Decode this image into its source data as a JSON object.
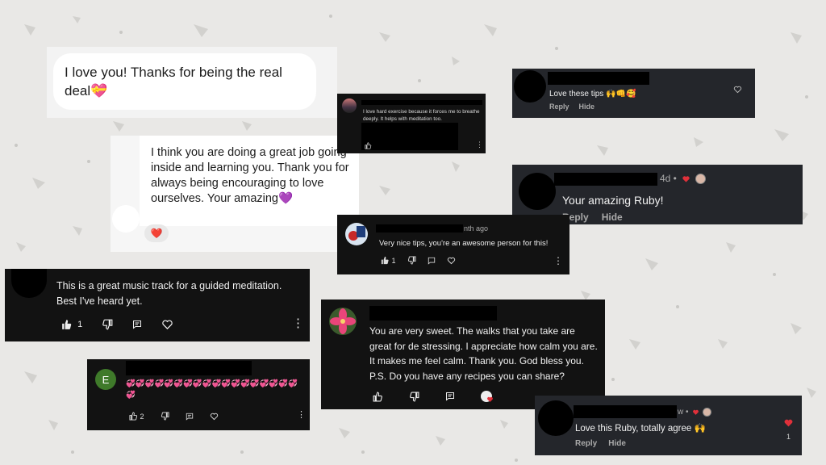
{
  "comments": {
    "c1": {
      "text": "I love you! Thanks for being the real deal",
      "emoji": "💝"
    },
    "c2": {
      "text": "I think you are doing a great job going inside and learning you. Thank you for always being encouraging to love ourselves. Your amazing",
      "emoji": "💜",
      "reaction": "❤️"
    },
    "c3": {
      "text": "I love hard exercise because it forces me to breathe deeply. It helps with meditation too."
    },
    "c4": {
      "text": "Love these tips",
      "emoji": "🙌👊🥰",
      "reply": "Reply",
      "hide": "Hide"
    },
    "c5": {
      "meta": "4d •",
      "text": "Your amazing Ruby!",
      "reply": "Reply",
      "hide": "Hide"
    },
    "c6": {
      "meta": "nth ago",
      "text": "Very nice tips, you're an awesome person for this!",
      "likes": "1"
    },
    "c7": {
      "text": "This is a great music track for a guided meditation. Best I've heard yet.",
      "likes": "1"
    },
    "c8": {
      "text": "You are very sweet. The walks that you take are great for de stressing. I appreciate how calm you are. It makes me feel calm. Thank you. God bless you. P.S. Do you have any recipes you can share?"
    },
    "c9": {
      "avatar_letter": "E",
      "emojis": "💞💞💞💞💞💞💞💞💞💞💞💞💞💞💞💞💞💞💞",
      "likes": "2"
    },
    "c10": {
      "meta": "w •",
      "text": "Love this Ruby, totally agree",
      "emoji": "🙌",
      "reply": "Reply",
      "hide": "Hide",
      "count": "1"
    }
  },
  "colors": {
    "heart": "#e0303a",
    "dark": "#121212",
    "dark2": "#24262b",
    "light": "#f6f6f6"
  }
}
